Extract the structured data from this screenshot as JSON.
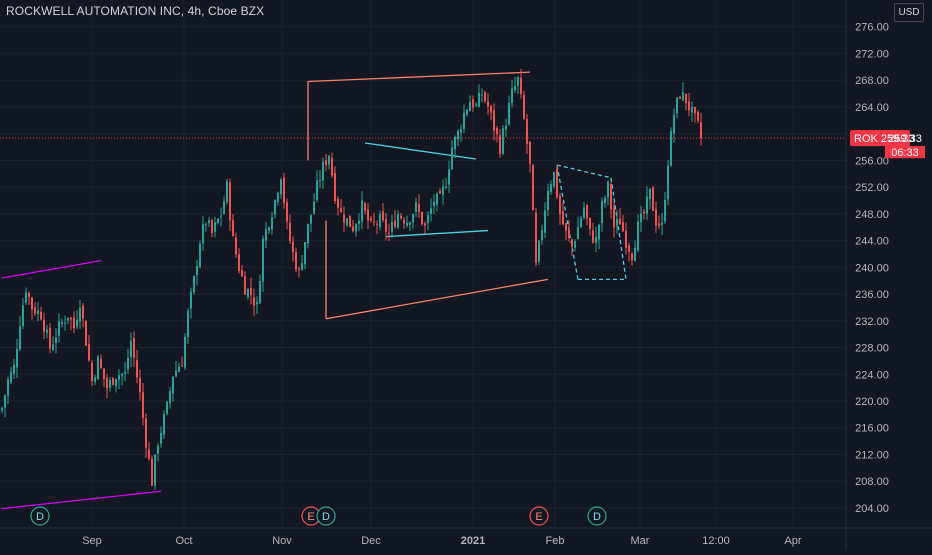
{
  "title": "ROCKWELL AUTOMATION INC, 4h, Cboe BZX",
  "currency": "USD",
  "colors": {
    "background": "#131722",
    "grid": "#1e222d",
    "up": "#26a69a",
    "down": "#ef5350",
    "axis_text": "#b2b5be",
    "price_tag": "#f23645",
    "trend_magenta": "#d500f9",
    "trend_salmon": "#f7816c",
    "trend_cyan": "#4dd0e1"
  },
  "price_tag": {
    "symbol": "ROK",
    "price": "259.33",
    "countdown": "06:33"
  },
  "chart_data": {
    "type": "candlestick",
    "title": "ROCKWELL AUTOMATION INC, 4h, Cboe BZX",
    "xlabel": "",
    "ylabel": "",
    "ylim": [
      201,
      277
    ],
    "y_ticks": [
      204,
      208,
      212,
      216,
      220,
      224,
      228,
      232,
      236,
      240,
      244,
      248,
      252,
      256,
      260,
      264,
      268,
      272,
      276
    ],
    "y_tick_labels": [
      "204.00",
      "208.00",
      "212.00",
      "216.00",
      "220.00",
      "224.00",
      "228.00",
      "232.00",
      "236.00",
      "240.00",
      "244.00",
      "248.00",
      "252.00",
      "256.00",
      "260.00",
      "264.00",
      "268.00",
      "272.00",
      "276.00"
    ],
    "x_ticks": [
      "Sep",
      "Oct",
      "Nov",
      "Dec",
      "2021",
      "Feb",
      "Mar",
      "12:00",
      "Apr"
    ],
    "last_price": 259.33,
    "grid": true,
    "price_path": [
      [
        0,
        219
      ],
      [
        2,
        223
      ],
      [
        4,
        225
      ],
      [
        6,
        232
      ],
      [
        8,
        237
      ],
      [
        10,
        234
      ],
      [
        13,
        233
      ],
      [
        16,
        228
      ],
      [
        19,
        231
      ],
      [
        22,
        233
      ],
      [
        24,
        231
      ],
      [
        26,
        235
      ],
      [
        28,
        229
      ],
      [
        30,
        223
      ],
      [
        32,
        226
      ],
      [
        35,
        222
      ],
      [
        38,
        224
      ],
      [
        41,
        224
      ],
      [
        43,
        229
      ],
      [
        46,
        221
      ],
      [
        48,
        214
      ],
      [
        50,
        208
      ],
      [
        52,
        214
      ],
      [
        55,
        219
      ],
      [
        57,
        224
      ],
      [
        60,
        226
      ],
      [
        62,
        233
      ],
      [
        64,
        238
      ],
      [
        66,
        244
      ],
      [
        68,
        247
      ],
      [
        70,
        245
      ],
      [
        73,
        248
      ],
      [
        75,
        252
      ],
      [
        77,
        244
      ],
      [
        79,
        240
      ],
      [
        81,
        237
      ],
      [
        83,
        236
      ],
      [
        85,
        234
      ],
      [
        87,
        244
      ],
      [
        89,
        247
      ],
      [
        91,
        250
      ],
      [
        93,
        254
      ],
      [
        95,
        246
      ],
      [
        97,
        242
      ],
      [
        99,
        239
      ],
      [
        101,
        244
      ],
      [
        103,
        248
      ],
      [
        105,
        252
      ],
      [
        107,
        255
      ],
      [
        109,
        257
      ],
      [
        111,
        251
      ],
      [
        113,
        248
      ],
      [
        115,
        247
      ],
      [
        117,
        246
      ],
      [
        120,
        249
      ],
      [
        123,
        246
      ],
      [
        126,
        247
      ],
      [
        129,
        245
      ],
      [
        132,
        248
      ],
      [
        135,
        247
      ],
      [
        138,
        249
      ],
      [
        141,
        246
      ],
      [
        144,
        250
      ],
      [
        146,
        250
      ],
      [
        148,
        253
      ],
      [
        150,
        258
      ],
      [
        152,
        260
      ],
      [
        154,
        263
      ],
      [
        156,
        265
      ],
      [
        158,
        264
      ],
      [
        160,
        266
      ],
      [
        162,
        264
      ],
      [
        164,
        261
      ],
      [
        166,
        258
      ],
      [
        168,
        262
      ],
      [
        170,
        266
      ],
      [
        172,
        268
      ],
      [
        174,
        262
      ],
      [
        176,
        255
      ],
      [
        178,
        240
      ],
      [
        180,
        246
      ],
      [
        182,
        252
      ],
      [
        184,
        254
      ],
      [
        186,
        248
      ],
      [
        188,
        245
      ],
      [
        190,
        243
      ],
      [
        192,
        246
      ],
      [
        194,
        249
      ],
      [
        196,
        245
      ],
      [
        198,
        244
      ],
      [
        200,
        249
      ],
      [
        202,
        252
      ],
      [
        204,
        246
      ],
      [
        206,
        247
      ],
      [
        208,
        244
      ],
      [
        210,
        242
      ],
      [
        212,
        246
      ],
      [
        214,
        248
      ],
      [
        216,
        251
      ],
      [
        218,
        247
      ],
      [
        220,
        246
      ],
      [
        222,
        256
      ],
      [
        224,
        263
      ],
      [
        226,
        266
      ],
      [
        228,
        265
      ],
      [
        230,
        263
      ],
      [
        232,
        261
      ],
      [
        233,
        259.33
      ]
    ],
    "events": [
      {
        "type": "dividend",
        "label": "D"
      },
      {
        "type": "earnings",
        "label": "E"
      },
      {
        "type": "dividend",
        "label": "D"
      },
      {
        "type": "earnings",
        "label": "E"
      },
      {
        "type": "dividend",
        "label": "D"
      }
    ],
    "drawings": [
      {
        "name": "upper-left-trendline",
        "color": "trend_magenta",
        "points": [
          [
            0,
            238.4
          ],
          [
            33,
            241
          ]
        ]
      },
      {
        "name": "lower-left-trendline",
        "color": "trend_magenta",
        "points": [
          [
            0,
            203.9
          ],
          [
            53,
            206.5
          ]
        ]
      },
      {
        "name": "wedge-upper",
        "color": "trend_salmon",
        "points": [
          [
            102,
            267.8
          ],
          [
            176,
            269.2
          ]
        ]
      },
      {
        "name": "wedge-lower",
        "color": "trend_salmon",
        "points": [
          [
            108,
            232.3
          ],
          [
            182,
            238.2
          ]
        ]
      },
      {
        "name": "wedge-left-edge",
        "color": "trend_salmon",
        "points": [
          [
            102,
            267.8
          ],
          [
            102,
            256
          ]
        ]
      },
      {
        "name": "wedge-left-edge-2",
        "color": "trend_salmon",
        "points": [
          [
            108,
            247
          ],
          [
            108,
            232.3
          ]
        ]
      },
      {
        "name": "pennant-upper",
        "color": "trend_cyan",
        "points": [
          [
            121,
            258.6
          ],
          [
            158,
            256.2
          ]
        ]
      },
      {
        "name": "pennant-lower",
        "color": "trend_cyan",
        "points": [
          [
            128,
            244.6
          ],
          [
            162,
            245.5
          ]
        ]
      },
      {
        "name": "flag-upper",
        "color": "trend_cyan",
        "dashed": true,
        "points": [
          [
            185,
            255.3
          ],
          [
            203,
            253.4
          ]
        ]
      },
      {
        "name": "flag-lower",
        "color": "trend_cyan",
        "dashed": true,
        "points": [
          [
            192,
            238.2
          ],
          [
            208,
            238.2
          ]
        ]
      },
      {
        "name": "flag-left",
        "color": "trend_cyan",
        "dashed": true,
        "points": [
          [
            192,
            238.2
          ],
          [
            185,
            255.3
          ]
        ]
      },
      {
        "name": "flag-right",
        "color": "trend_cyan",
        "dashed": true,
        "points": [
          [
            203,
            253.4
          ],
          [
            208,
            238.2
          ]
        ]
      }
    ]
  }
}
